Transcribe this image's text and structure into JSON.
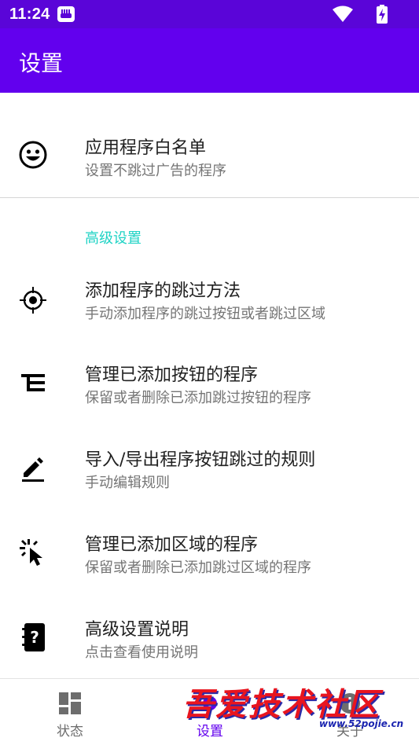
{
  "status_bar": {
    "time": "11:24"
  },
  "app_bar": {
    "title": "设置"
  },
  "items": [
    {
      "title": "应用程序白名单",
      "subtitle": "设置不跳过广告的程序",
      "icon": "smiley-icon"
    },
    {
      "title": "添加程序的跳过方法",
      "subtitle": "手动添加程序的跳过按钮或者跳过区域",
      "icon": "crosshair-icon"
    },
    {
      "title": "管理已添加按钮的程序",
      "subtitle": "保留或者删除已添加跳过按钮的程序",
      "icon": "tree-list-icon"
    },
    {
      "title": "导入/导出程序按钮跳过的规则",
      "subtitle": "手动编辑规则",
      "icon": "pencil-icon"
    },
    {
      "title": "管理已添加区域的程序",
      "subtitle": "保留或者删除已添加跳过区域的程序",
      "icon": "cursor-click-icon"
    },
    {
      "title": "高级设置说明",
      "subtitle": "点击查看使用说明",
      "icon": "help-notebook-icon"
    }
  ],
  "section_header": "高级设置",
  "bottom_nav": {
    "tabs": [
      {
        "label": "状态",
        "icon": "dashboard-icon"
      },
      {
        "label": "设置",
        "icon": "settings-icon",
        "active": true
      },
      {
        "label": "关于",
        "icon": "info-icon"
      }
    ],
    "active_color": "#6200ee"
  },
  "watermark": {
    "text": "吾爱技术社区",
    "url": "www.52pojie.cn"
  },
  "colors": {
    "primary": "#6200ee",
    "primary_dark": "#5a05d8",
    "accent": "#1fd3c5"
  }
}
